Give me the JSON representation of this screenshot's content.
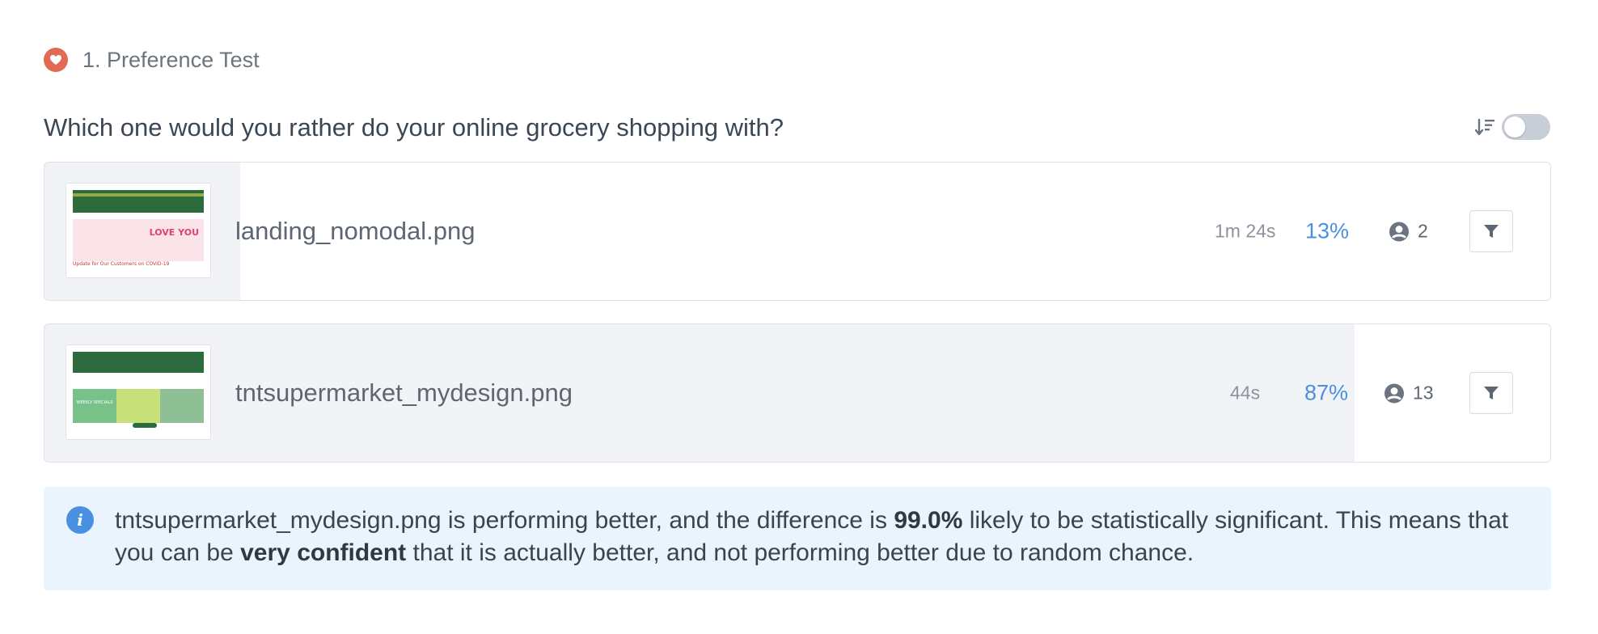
{
  "section": {
    "title": "1. Preference Test",
    "badge_color": "#e26a55",
    "icon": "heart-icon"
  },
  "question": "Which one would you rather do your online grocery shopping with?",
  "sort_toggle": {
    "icon": "sort-icon",
    "enabled": false
  },
  "options": [
    {
      "filename": "landing_nomodal.png",
      "duration": "1m 24s",
      "percent": "13%",
      "share": 0.13,
      "users": "2",
      "thumbnail_text": "LOVE YOU",
      "thumbnail_subtext": "Update for Our Customers on COVID-19"
    },
    {
      "filename": "tntsupermarket_mydesign.png",
      "duration": "44s",
      "percent": "87%",
      "share": 0.87,
      "users": "13",
      "thumbnail_text": "WEEKLY SPECIALS"
    }
  ],
  "info": {
    "part1": "tntsupermarket_mydesign.png is performing better, and the difference is ",
    "bold1": "99.0%",
    "part2": " likely to be statistically significant. This means that you can be ",
    "bold2": "very confident",
    "part3": " that it is actually better, and not performing better due to random chance."
  },
  "colors": {
    "accent": "#4a90e2",
    "fill": "#f2f3f7",
    "info_bg": "#eaf4fd"
  }
}
